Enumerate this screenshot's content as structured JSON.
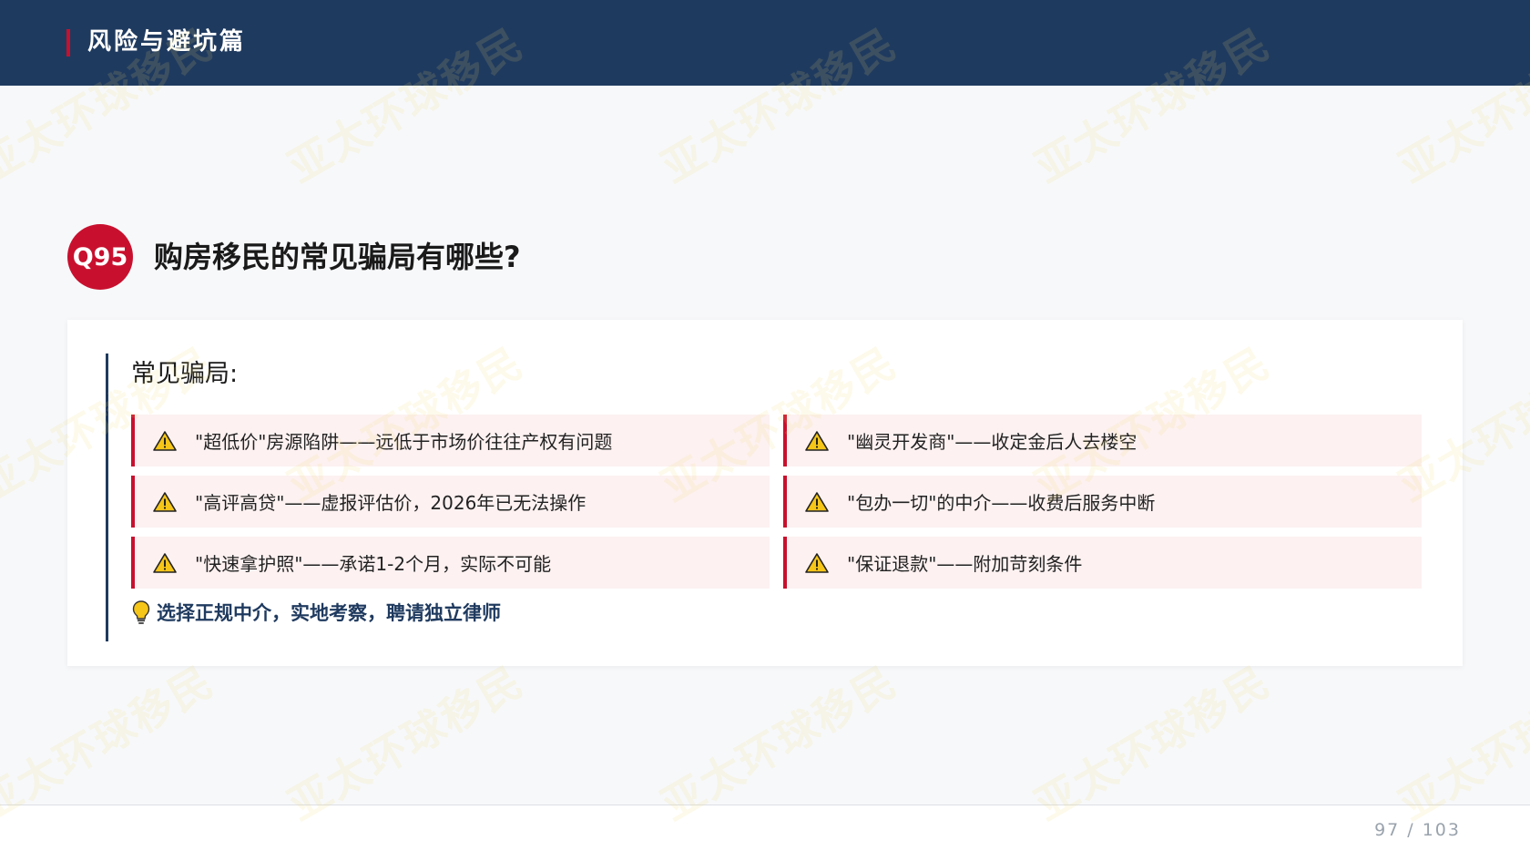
{
  "header": {
    "title": "风险与避坑篇"
  },
  "question": {
    "badge": "Q95",
    "title": "购房移民的常见骗局有哪些?"
  },
  "card": {
    "heading": "常见骗局:",
    "items": [
      {
        "text": "\"超低价\"房源陷阱——远低于市场价往往产权有问题",
        "icon": "warning-icon"
      },
      {
        "text": "\"幽灵开发商\"——收定金后人去楼空",
        "icon": "warning-icon"
      },
      {
        "text": "\"高评高贷\"——虚报评估价，2026年已无法操作",
        "icon": "warning-icon"
      },
      {
        "text": "\"包办一切\"的中介——收费后服务中断",
        "icon": "warning-icon"
      },
      {
        "text": "\"快速拿护照\"——承诺1-2个月，实际不可能",
        "icon": "warning-icon"
      },
      {
        "text": "\"保证退款\"——附加苛刻条件",
        "icon": "warning-icon"
      }
    ],
    "tip": {
      "icon": "lightbulb-icon",
      "text": "选择正规中介，实地考察，聘请独立律师"
    }
  },
  "watermark": "亚太环球移民",
  "footer": {
    "page": "97 / 103"
  },
  "colors": {
    "navy": "#1f3a5f",
    "red": "#c8102e",
    "item_bg": "#fdf1f1"
  }
}
